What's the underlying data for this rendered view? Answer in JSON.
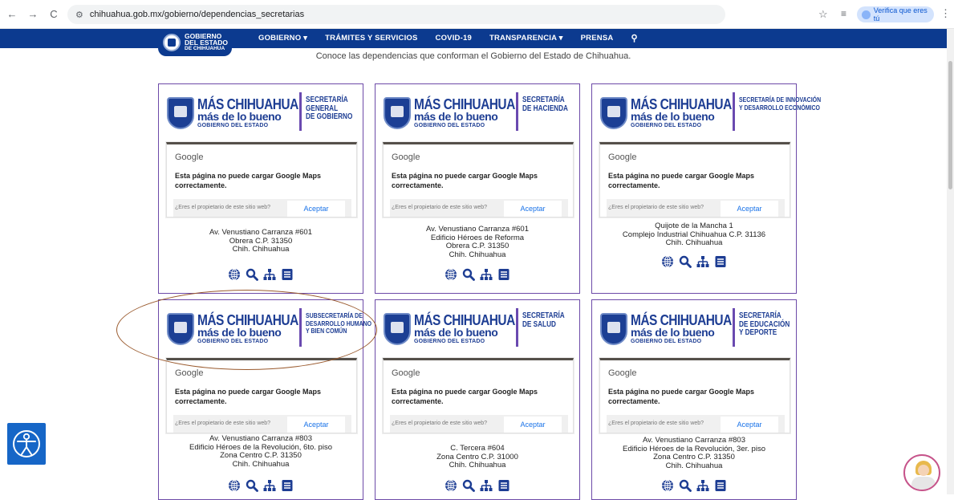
{
  "browser": {
    "url": "chihuahua.gob.mx/gobierno/dependencias_secretarias",
    "verify_label": "Verifica que eres tú"
  },
  "site": {
    "logo_line1": "GOBIERNO",
    "logo_line2": "DEL ESTADO",
    "logo_line3": "DE CHIHUAHUA",
    "menu": [
      "GOBIERNO ▾",
      "TRÁMITES Y SERVICIOS",
      "COVID-19",
      "TRANSPARENCIA ▾",
      "PRENSA"
    ],
    "intro": "Conoce las dependencias que conforman el Gobierno del Estado de Chihuahua."
  },
  "brand": {
    "line1": "MÁS CHIHUAHUA",
    "line2": "más de lo bueno",
    "line3": "GOBIERNO DEL ESTADO"
  },
  "map": {
    "google": "Google",
    "message": "Esta página no puede cargar Google Maps correctamente.",
    "owner_question": "¿Eres el propietario de este sitio web?",
    "accept": "Aceptar"
  },
  "cards": [
    {
      "secretariat": [
        "SECRETARÍA",
        "GENERAL",
        "DE GOBIERNO"
      ],
      "address": [
        "Av. Venustiano Carranza #601",
        "Obrera C.P. 31350",
        "Chih. Chihuahua"
      ]
    },
    {
      "secretariat": [
        "SECRETARÍA",
        "DE HACIENDA"
      ],
      "address": [
        "Av. Venustiano Carranza #601",
        "Edificio Héroes de Reforma",
        "Obrera C.P. 31350",
        "Chih. Chihuahua"
      ]
    },
    {
      "secretariat": [
        "SECRETARÍA DE INNOVACIÓN",
        "Y DESARROLLO ECONÓMICO"
      ],
      "address": [
        "Quijote de la Mancha 1",
        "Complejo Industrial Chihuahua C.P. 31136",
        "Chih. Chihuahua"
      ]
    },
    {
      "secretariat": [
        "SUBSECRETARÍA DE",
        "DESARROLLO HUMANO",
        "Y BIEN COMÚN"
      ],
      "address": [
        "Av. Venustiano Carranza #803",
        "Edificio Héroes de la Revolución, 6to. piso",
        "Zona Centro C.P. 31350",
        "Chih. Chihuahua"
      ]
    },
    {
      "secretariat": [
        "SECRETARÍA",
        "DE SALUD"
      ],
      "address": [
        "C. Tercera #604",
        "Zona Centro C.P. 31000",
        "Chih. Chihuahua"
      ]
    },
    {
      "secretariat": [
        "SECRETARÍA",
        "DE EDUCACIÓN",
        "Y DEPORTE"
      ],
      "address": [
        "Av. Venustiano Carranza #803",
        "Edificio Héroes de la Revolución, 3er. piso",
        "Zona Centro C.P. 31350",
        "Chih. Chihuahua"
      ]
    }
  ],
  "icons": [
    "globe-icon",
    "search-icon",
    "org-chart-icon",
    "document-icon"
  ],
  "colors": {
    "nav_blue": "#0c3a8f",
    "brand_blue": "#1d3d93",
    "card_border": "#6d4aa8",
    "annotation": "#9a5a2e",
    "accessibility_button": "#1666c7"
  }
}
